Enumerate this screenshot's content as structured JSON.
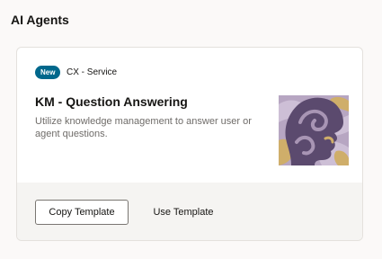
{
  "section": {
    "title": "AI Agents"
  },
  "card": {
    "badge": "New",
    "category": "CX - Service",
    "title": "KM - Question Answering",
    "description": "Utilize knowledge management to answer user or agent questions.",
    "illustration_icon": "head-profile-illustration",
    "actions": {
      "copy_label": "Copy Template",
      "use_label": "Use Template"
    }
  },
  "colors": {
    "badge": "#00688c",
    "illustration_purple": "#5b4a6e",
    "illustration_gold": "#cfae6a",
    "illustration_lavender": "#a895b4"
  }
}
